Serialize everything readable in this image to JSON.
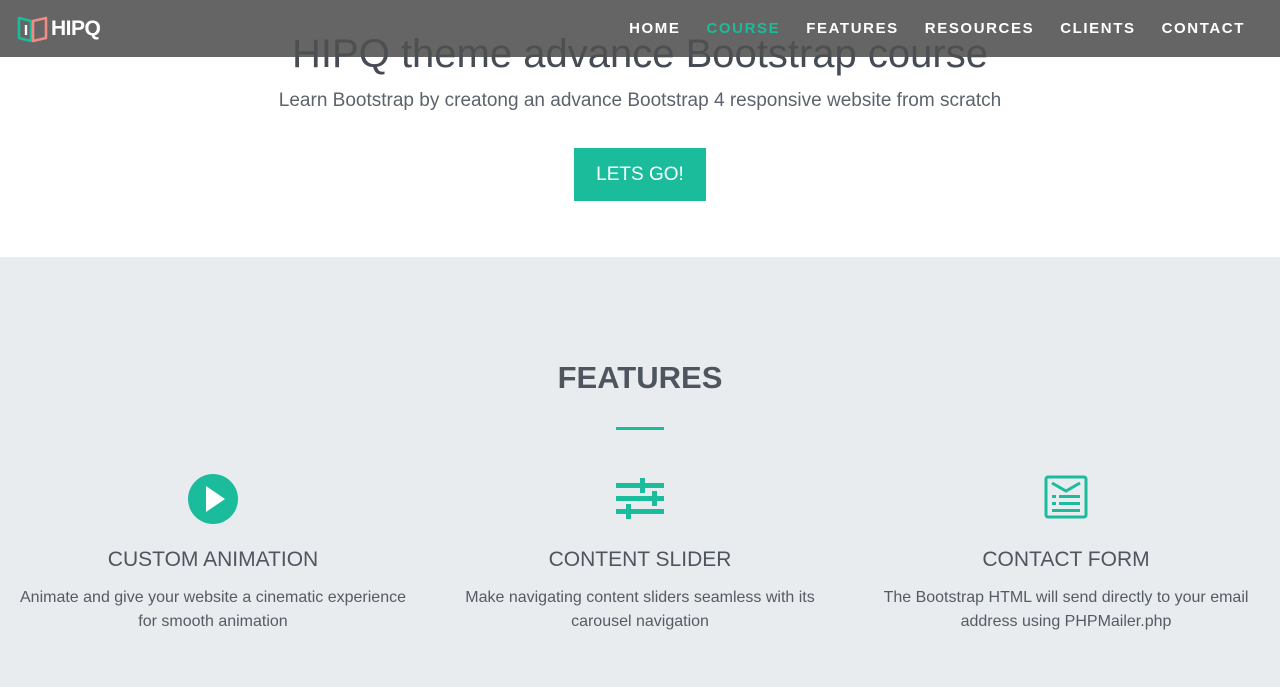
{
  "brand": {
    "name": "HIPQ",
    "logo_icon": "hipq-logo-icon"
  },
  "nav": {
    "items": [
      {
        "label": "HOME",
        "active": false
      },
      {
        "label": "COURSE",
        "active": true
      },
      {
        "label": "FEATURES",
        "active": false
      },
      {
        "label": "RESOURCES",
        "active": false
      },
      {
        "label": "CLIENTS",
        "active": false
      },
      {
        "label": "CONTACT",
        "active": false
      }
    ]
  },
  "hero": {
    "title": "HIPQ theme advance Bootstrap course",
    "subtitle": "Learn Bootstrap by creatong an advance Bootstrap 4 responsive website from scratch",
    "cta_label": "LETS GO!"
  },
  "features": {
    "title": "FEATURES",
    "items": [
      {
        "icon": "play-circle-icon",
        "title": "CUSTOM ANIMATION",
        "description": "Animate and give your website a cinematic experience for smooth animation"
      },
      {
        "icon": "sliders-icon",
        "title": "CONTENT SLIDER",
        "description": "Make navigating content sliders seamless with its carousel navigation"
      },
      {
        "icon": "contact-form-icon",
        "title": "CONTACT FORM",
        "description": "The Bootstrap HTML will send directly to your email address using PHPMailer.php"
      }
    ]
  },
  "colors": {
    "accent": "#1abc9c",
    "navbar": "#505050",
    "section_bg": "#e8ecef",
    "text": "#4a505a"
  }
}
